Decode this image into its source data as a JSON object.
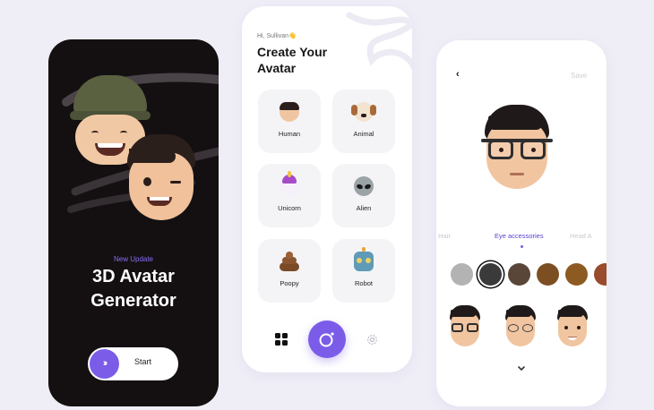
{
  "splash": {
    "tag": "New Update",
    "title_line1": "3D Avatar",
    "title_line2": "Generator",
    "start_label": "Start",
    "start_icon": "double-chevron-right-icon"
  },
  "create": {
    "greeting": "Hi, Sullivan👋",
    "title": "Create Your Avatar",
    "categories": [
      {
        "label": "Human",
        "icon": "human-face-icon"
      },
      {
        "label": "Animal",
        "icon": "dog-face-icon"
      },
      {
        "label": "Unicorn",
        "icon": "unicorn-face-icon"
      },
      {
        "label": "Alien",
        "icon": "alien-face-icon"
      },
      {
        "label": "Poopy",
        "icon": "poop-icon"
      },
      {
        "label": "Robot",
        "icon": "robot-face-icon"
      }
    ],
    "nav": [
      "grid-icon",
      "camera-icon",
      "settings-gear-icon"
    ]
  },
  "editor": {
    "back_icon": "chevron-left-icon",
    "save_label": "Save",
    "tabs": [
      "Facial Hair",
      "Eye accessories",
      "Head A"
    ],
    "active_tab": "Eye accessories",
    "swatches": [
      "#b3b3b3",
      "#3a3a3a",
      "#5a4638",
      "#7c4f22",
      "#8d5a22",
      "#9a4b2c"
    ],
    "selected_swatch": 1,
    "expand_icon": "chevron-down-icon"
  },
  "colors": {
    "accent": "#7b5ce8",
    "dark_bg": "#141012",
    "page_bg": "#efedf6"
  }
}
